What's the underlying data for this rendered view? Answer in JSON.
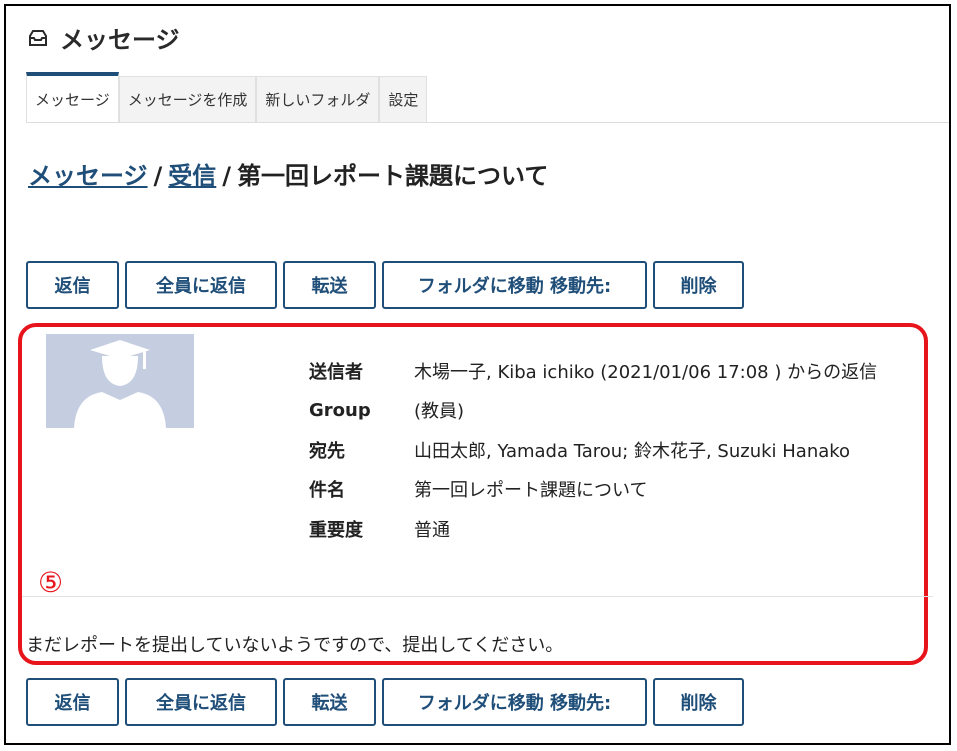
{
  "header": {
    "title": "メッセージ",
    "icon": "inbox-icon"
  },
  "tabs": [
    {
      "label": "メッセージ",
      "active": true
    },
    {
      "label": "メッセージを作成",
      "active": false
    },
    {
      "label": "新しいフォルダ",
      "active": false
    },
    {
      "label": "設定",
      "active": false
    }
  ],
  "breadcrumb": {
    "root": "メッセージ",
    "folder": "受信",
    "current": "第一回レポート課題について",
    "separator": "/"
  },
  "toolbar": {
    "reply": "返信",
    "reply_all": "全員に返信",
    "forward": "転送",
    "move": "フォルダに移動 移動先:",
    "delete": "削除"
  },
  "message": {
    "fields": [
      {
        "key": "送信者",
        "value": "木場一子, Kiba ichiko (2021/01/06 17:08 ) からの返信"
      },
      {
        "key": "Group",
        "value": "(教員)"
      },
      {
        "key": "宛先",
        "value": "山田太郎, Yamada Tarou; 鈴木花子, Suzuki Hanako"
      },
      {
        "key": "件名",
        "value": "第一回レポート課題について"
      },
      {
        "key": "重要度",
        "value": "普通"
      }
    ],
    "body": "まだレポートを提出していないようですので、提出してください。"
  },
  "annotation": {
    "number": "⑤",
    "color": "#e8141b"
  },
  "colors": {
    "accent": "#1f4e79",
    "highlight": "#e8141b",
    "avatar_bg": "#c5cde0"
  }
}
